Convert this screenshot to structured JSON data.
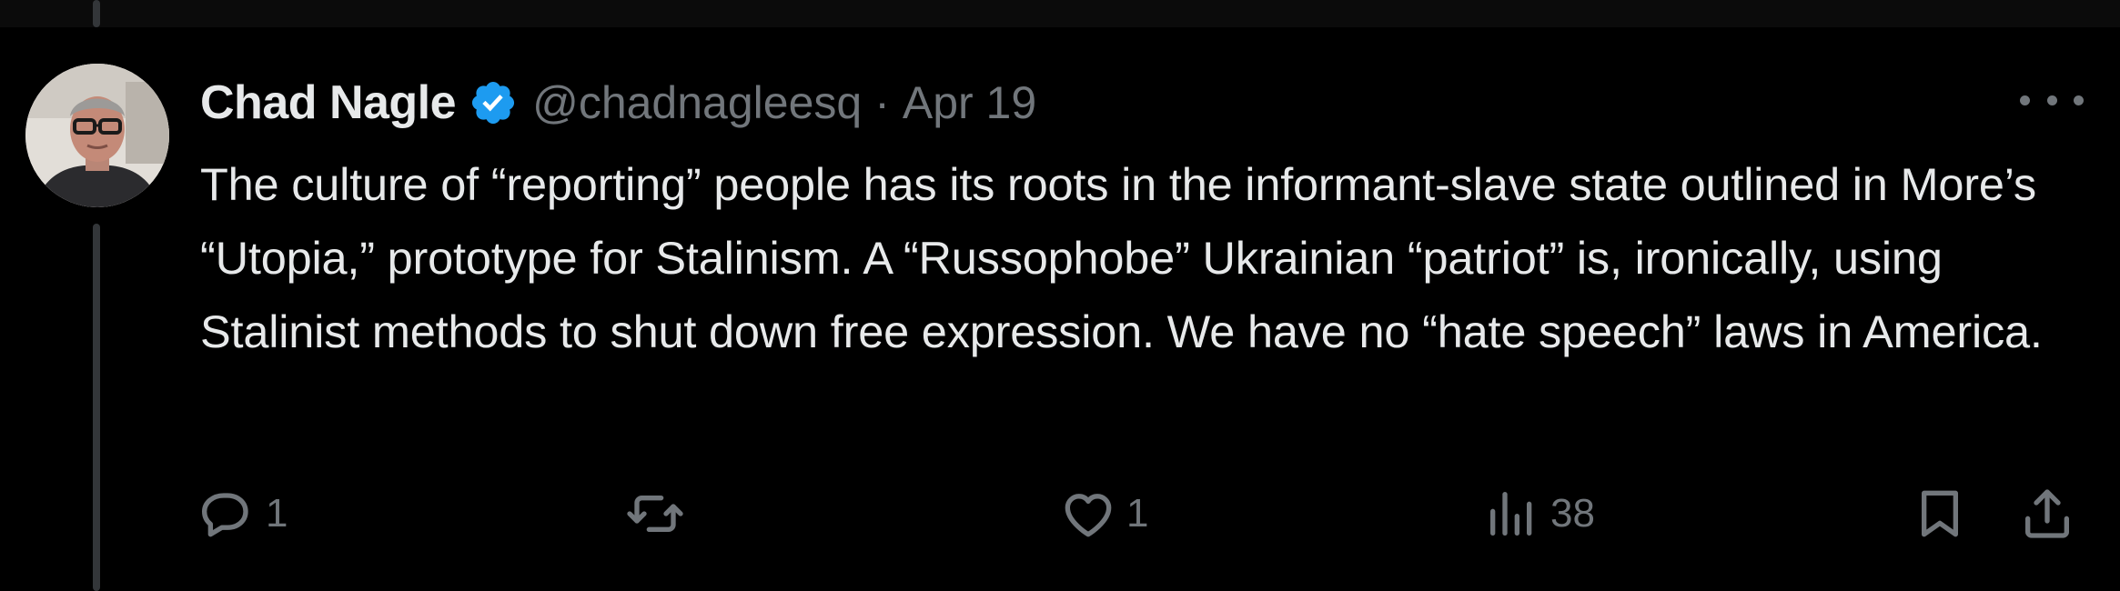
{
  "post": {
    "author_name": "Chad Nagle",
    "handle": "@chadnagleesq",
    "separator": "·",
    "date": "Apr 19",
    "text": "The culture of “reporting” people has its roots in the informant-slave state outlined in More’s “Utopia,” prototype for Stalinism. A “Russophobe” Ukrainian “patriot” is, ironically, using Stalinist methods to shut down free expression. We have no “hate speech” laws in America.",
    "verified": true
  },
  "actions": {
    "reply_count": "1",
    "repost_count": "",
    "like_count": "1",
    "views_count": "38"
  },
  "icons": {
    "verified": "verified-badge-icon",
    "more": "more-icon",
    "reply": "reply-icon",
    "repost": "repost-icon",
    "like": "heart-icon",
    "views": "views-icon",
    "bookmark": "bookmark-icon",
    "share": "share-icon"
  },
  "colors": {
    "background": "#000000",
    "text": "#e7e9ea",
    "secondary_text": "#71767b",
    "verified_blue": "#1d9bf0",
    "thread_line": "#333639"
  }
}
